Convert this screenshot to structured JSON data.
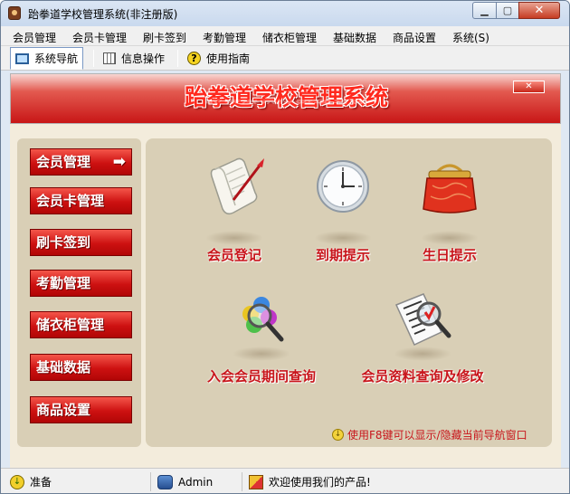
{
  "window": {
    "title": "跆拳道学校管理系统(非注册版)",
    "min_glyph": "▁",
    "max_glyph": "▢",
    "close_glyph": "✕"
  },
  "menu": {
    "items": [
      "会员管理",
      "会员卡管理",
      "刷卡签到",
      "考勤管理",
      "储衣柜管理",
      "基础数据",
      "商品设置",
      "系统(S)"
    ]
  },
  "toolbar": {
    "buttons": [
      {
        "label": "系统导航",
        "icon": "monitor-icon",
        "active": true
      },
      {
        "label": "信息操作",
        "icon": "table-icon",
        "active": false
      },
      {
        "label": "使用指南",
        "icon": "help-icon",
        "active": false
      }
    ]
  },
  "banner": {
    "title": "跆拳道学校管理系统",
    "close_glyph": "✕"
  },
  "sidebar": {
    "items": [
      {
        "label": "会员管理",
        "arrow": "➡"
      },
      {
        "label": "会员卡管理"
      },
      {
        "label": "刷卡签到"
      },
      {
        "label": "考勤管理"
      },
      {
        "label": "储衣柜管理"
      },
      {
        "label": "基础数据"
      },
      {
        "label": "商品设置"
      }
    ]
  },
  "features": {
    "items": [
      {
        "label": "会员登记",
        "icon": "scroll-quill-icon"
      },
      {
        "label": "到期提示",
        "icon": "clock-icon"
      },
      {
        "label": "生日提示",
        "icon": "red-purse-icon"
      },
      {
        "label": "入会会员期间查询",
        "icon": "colorful-magnifier-icon"
      },
      {
        "label": "会员资料查询及修改",
        "icon": "document-magnifier-icon"
      }
    ]
  },
  "hint": {
    "text": "使用F8键可以显示/隐藏当前导航窗口",
    "icon": "hint-icon"
  },
  "status": {
    "ready": "准备",
    "user": "Admin",
    "welcome": "欢迎使用我们的产品!"
  },
  "colors": {
    "accent_red": "#c8151b",
    "button_red": "#cd1111",
    "panel_beige": "#d9cfb6"
  }
}
